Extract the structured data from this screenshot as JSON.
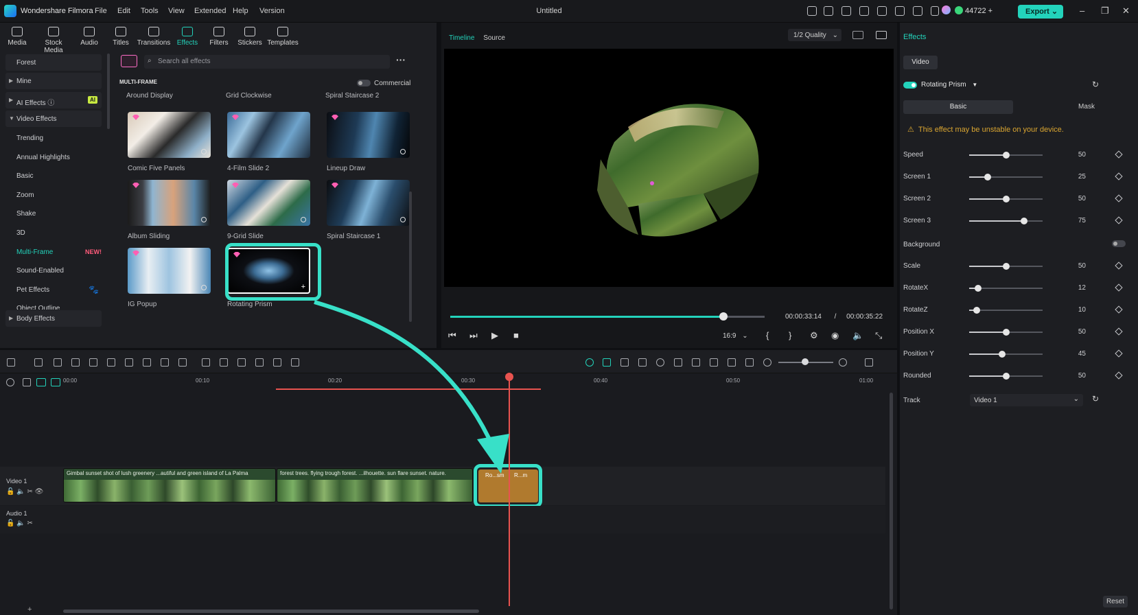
{
  "app": {
    "name": "Wondershare Filmora",
    "doc_title": "Untitled",
    "credits": "44722",
    "export_label": "Export"
  },
  "menu": [
    "File",
    "Edit",
    "Tools",
    "View",
    "Extended",
    "Help",
    "Version"
  ],
  "tool_tabs": [
    {
      "label": "Media",
      "icon": "media-icon"
    },
    {
      "label": "Stock Media",
      "icon": "stock-media-icon"
    },
    {
      "label": "Audio",
      "icon": "audio-icon"
    },
    {
      "label": "Titles",
      "icon": "titles-icon"
    },
    {
      "label": "Transitions",
      "icon": "transitions-icon"
    },
    {
      "label": "Effects",
      "icon": "effects-icon",
      "active": true
    },
    {
      "label": "Filters",
      "icon": "filters-icon"
    },
    {
      "label": "Stickers",
      "icon": "stickers-icon"
    },
    {
      "label": "Templates",
      "icon": "templates-icon"
    }
  ],
  "categories": {
    "forest": "Forest",
    "mine": "Mine",
    "ai_effects": "AI Effects",
    "ai_badge": "AI",
    "video_effects": "Video Effects",
    "subs": [
      "Trending",
      "Annual Highlights",
      "Basic",
      "Zoom",
      "Shake",
      "3D",
      "Multi-Frame",
      "Sound-Enabled",
      "Pet Effects",
      "Object Outline"
    ],
    "new_badge": "NEW!",
    "body_effects": "Body Effects"
  },
  "search": {
    "placeholder": "Search all effects"
  },
  "section": {
    "title": "MULTI-FRAME",
    "commercial": "Commercial"
  },
  "top_row_labels": [
    "Around Display",
    "Grid Clockwise",
    "Spiral Staircase 2"
  ],
  "tiles": [
    {
      "label": "Comic Five Panels"
    },
    {
      "label": "4-Film Slide 2"
    },
    {
      "label": "Lineup Draw"
    },
    {
      "label": "Album Sliding"
    },
    {
      "label": "9-Grid Slide"
    },
    {
      "label": "Spiral Staircase 1"
    },
    {
      "label": "IG Popup"
    },
    {
      "label": "Rotating Prism"
    }
  ],
  "preview": {
    "tab_timeline": "Timeline",
    "tab_source": "Source",
    "quality": "1/2 Quality",
    "current_time": "00:00:33:14",
    "separator": "/",
    "total_time": "00:00:35:22",
    "aspect": "16:9",
    "progress": 0.87
  },
  "props": {
    "title": "Effects",
    "video_tab": "Video",
    "effect_name": "Rotating Prism",
    "tab_basic": "Basic",
    "tab_mask": "Mask",
    "warning": "This effect may be unstable on your device.",
    "params": [
      {
        "label": "Speed",
        "value": 50,
        "max": 100
      },
      {
        "label": "Screen 1",
        "value": 25,
        "max": 100
      },
      {
        "label": "Screen 2",
        "value": 50,
        "max": 100
      },
      {
        "label": "Screen 3",
        "value": 75,
        "max": 100
      }
    ],
    "background_label": "Background",
    "params2": [
      {
        "label": "Scale",
        "value": 50,
        "max": 100
      },
      {
        "label": "RotateX",
        "value": 12,
        "max": 100
      },
      {
        "label": "RotateZ",
        "value": 10,
        "max": 100
      },
      {
        "label": "Position X",
        "value": 50,
        "max": 100
      },
      {
        "label": "Position Y",
        "value": 45,
        "max": 100
      },
      {
        "label": "Rounded",
        "value": 50,
        "max": 100
      }
    ],
    "track_label": "Track",
    "track_value": "Video 1",
    "reset": "Reset"
  },
  "timeline": {
    "ticks": [
      "00:00",
      "00:10",
      "00:20",
      "00:30",
      "00:40",
      "00:50",
      "01:00"
    ],
    "video_track": "Video 1",
    "audio_track": "Audio 1",
    "clip1": "Gimbal sunset shot of lush greenery ...autiful and green island of La Palma",
    "clip2": "forest trees. flying trough forest. ...ilhouette. sun flare sunset. nature.",
    "fx_clip_a": "Ro...sm",
    "fx_clip_b": "R...m"
  },
  "colors": {
    "accent": "#23d3bb",
    "highlight": "#38e0c8",
    "playhead": "#e8534f",
    "fx_clip": "#b07a2e",
    "warning": "#d9a531"
  }
}
